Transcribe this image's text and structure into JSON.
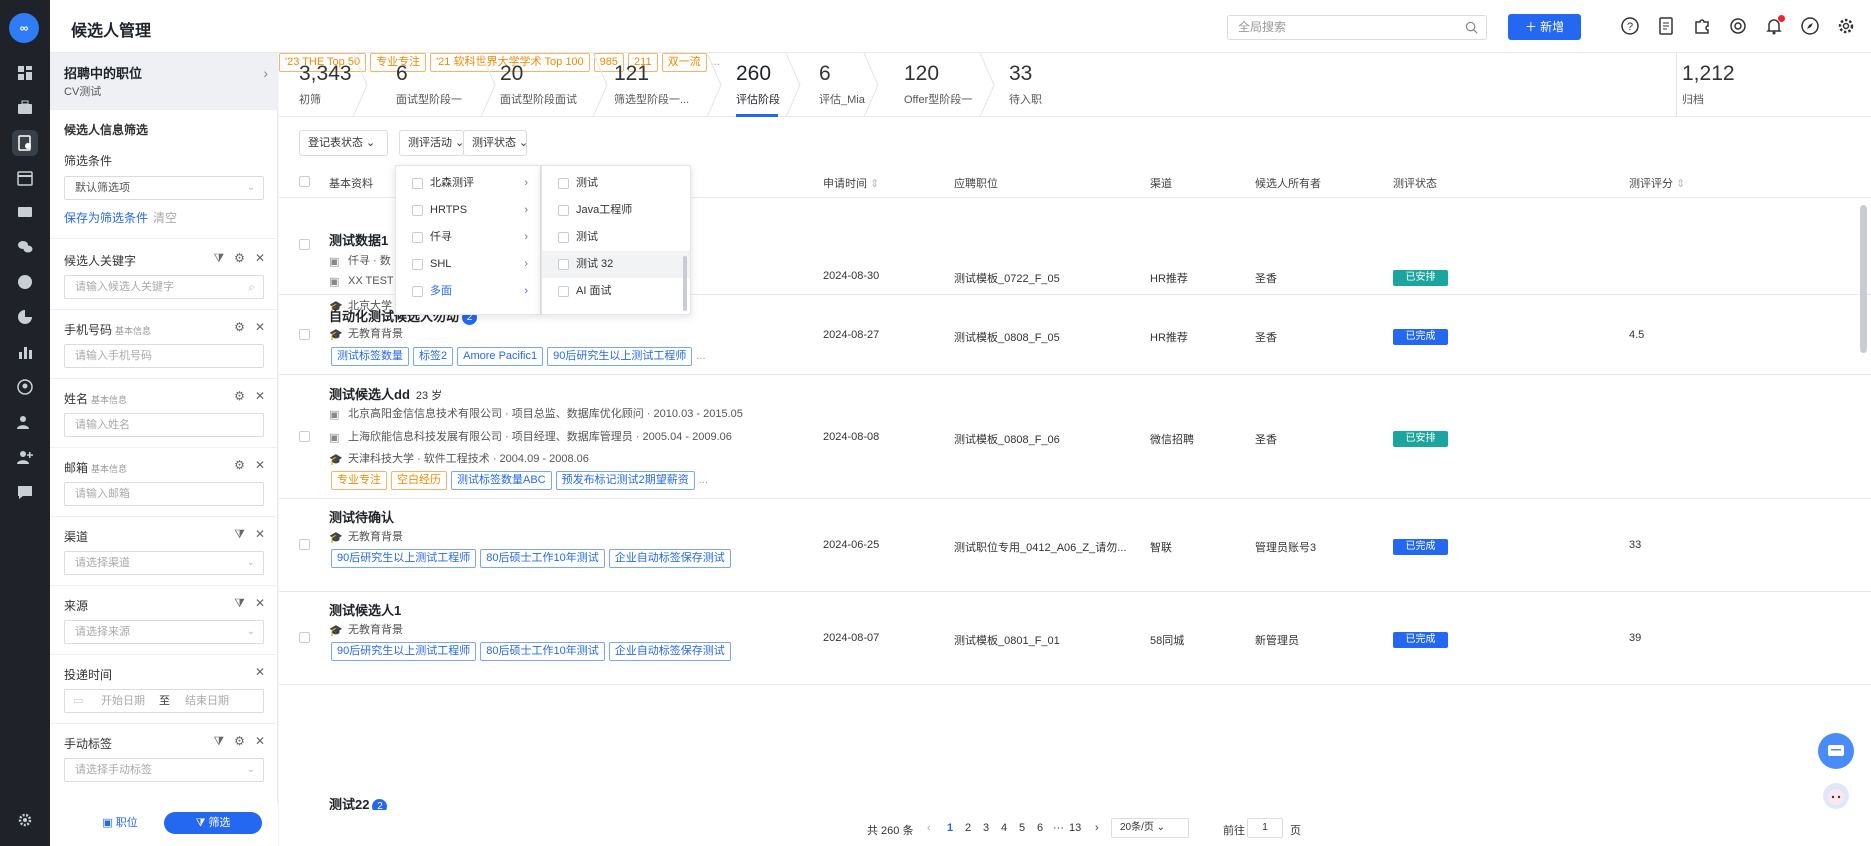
{
  "app": {
    "title": "候选人管理",
    "logo_text": "∞"
  },
  "topbar": {
    "search_placeholder": "全局搜索",
    "new_button": "＋ 新增",
    "tools": [
      "help-icon",
      "document-icon",
      "puzzle-icon",
      "support-icon",
      "bell-icon",
      "compass-icon",
      "gear-icon"
    ]
  },
  "filter_panel": {
    "header_title": "招聘中的职位",
    "header_sub": "CV测试",
    "section_title": "候选人信息筛选",
    "conditions_label": "筛选条件",
    "conditions_value": "默认筛选项",
    "save_link": "保存为筛选条件",
    "clear_link": "清空",
    "fields": [
      {
        "label": "候选人关键字",
        "tag": "",
        "placeholder": "请输入候选人关键字"
      },
      {
        "label": "手机号码",
        "tag": "基本信息",
        "placeholder": "请输入手机号码"
      },
      {
        "label": "姓名",
        "tag": "基本信息",
        "placeholder": "请输入姓名"
      },
      {
        "label": "邮箱",
        "tag": "基本信息",
        "placeholder": "请输入邮箱"
      },
      {
        "label": "渠道",
        "tag": "",
        "placeholder": "请选择渠道"
      },
      {
        "label": "来源",
        "tag": "",
        "placeholder": "请选择来源"
      },
      {
        "label": "投递时间",
        "tag": "",
        "start": "开始日期",
        "to": "至",
        "end": "结束日期"
      },
      {
        "label": "手动标签",
        "tag": "",
        "placeholder": "请选择手动标签"
      }
    ],
    "bottom_tabs": [
      "职位",
      "筛选"
    ]
  },
  "stages": [
    {
      "count": "3,343",
      "label": "初筛"
    },
    {
      "count": "6",
      "label": "面试型阶段一"
    },
    {
      "count": "20",
      "label": "面试型阶段面试"
    },
    {
      "count": "121",
      "label": "筛选型阶段一..."
    },
    {
      "count": "260",
      "label": "评估阶段",
      "active": true
    },
    {
      "count": "6",
      "label": "评估_Mia"
    },
    {
      "count": "120",
      "label": "Offer型阶段一"
    },
    {
      "count": "33",
      "label": "待入职"
    },
    {
      "count": "1,212",
      "label": "归档"
    }
  ],
  "filter_buttons": [
    "登记表状态",
    "测评活动",
    "测评状态"
  ],
  "table": {
    "headers": [
      "基本资料",
      "申请时间",
      "应聘职位",
      "渠道",
      "候选人所有者",
      "测评状态",
      "测评评分"
    ],
    "rows": [
      {
        "name": "测试数据1",
        "badge": "",
        "lines": [
          "仟寻 · 数",
          "XX TEST",
          "北京大学"
        ],
        "tags": [
          {
            "t": "'23 THE Top 50",
            "c": "o"
          },
          {
            "t": "专业专注",
            "c": "o"
          },
          {
            "t": "'21 软科世界大学学术 Top 100",
            "c": "o"
          },
          {
            "t": "985",
            "c": "o"
          },
          {
            "t": "211",
            "c": "o"
          },
          {
            "t": "双一流",
            "c": "o"
          }
        ],
        "date": "2024-08-30",
        "position": "测试模板_0722_F_05",
        "channel": "HR推荐",
        "owner": "圣香",
        "status": "已安排",
        "status_color": "teal",
        "score": ""
      },
      {
        "name": "自动化测试候选人勿动",
        "badge": "2",
        "lines": [
          "无教育背景"
        ],
        "tags": [
          {
            "t": "测试标签数量",
            "c": "b"
          },
          {
            "t": "标签2",
            "c": "b"
          },
          {
            "t": "Amore Pacific1",
            "c": "b"
          },
          {
            "t": "90后研究生以上测试工程师",
            "c": "b"
          }
        ],
        "date": "2024-08-27",
        "position": "测试模板_0808_F_05",
        "channel": "HR推荐",
        "owner": "圣香",
        "status": "已完成",
        "status_color": "blue",
        "score": "4.5"
      },
      {
        "name": "测试候选人dd",
        "badge": "",
        "age": "23 岁",
        "lines": [
          "北京高阳金信信息技术有限公司 · 项目总监、数据库优化顾问 · 2010.03 - 2015.05",
          "上海欣能信息科技发展有限公司 · 项目经理、数据库管理员 · 2005.04 - 2009.06",
          "天津科技大学 · 软件工程技术 · 2004.09 - 2008.06"
        ],
        "tags": [
          {
            "t": "专业专注",
            "c": "o"
          },
          {
            "t": "空白经历",
            "c": "o"
          },
          {
            "t": "测试标签数量ABC",
            "c": "b"
          },
          {
            "t": "预发布标记测试2期望薪资",
            "c": "b"
          }
        ],
        "date": "2024-08-08",
        "position": "测试模板_0808_F_06",
        "channel": "微信招聘",
        "owner": "圣香",
        "status": "已安排",
        "status_color": "teal",
        "score": ""
      },
      {
        "name": "测试待确认",
        "badge": "",
        "lines": [
          "无教育背景"
        ],
        "tags": [
          {
            "t": "90后研究生以上测试工程师",
            "c": "b"
          },
          {
            "t": "80后硕士工作10年测试",
            "c": "b"
          },
          {
            "t": "企业自动标签保存测试",
            "c": "b"
          }
        ],
        "date": "2024-06-25",
        "position": "测试职位专用_0412_A06_Z_请勿...",
        "channel": "智联",
        "owner": "管理员账号3",
        "status": "已完成",
        "status_color": "blue",
        "score": "33"
      },
      {
        "name": "测试候选人1",
        "badge": "",
        "lines": [
          "无教育背景"
        ],
        "tags": [
          {
            "t": "90后研究生以上测试工程师",
            "c": "b"
          },
          {
            "t": "80后硕士工作10年测试",
            "c": "b"
          },
          {
            "t": "企业自动标签保存测试",
            "c": "b"
          }
        ],
        "date": "2024-08-07",
        "position": "测试模板_0801_F_01",
        "channel": "58同城",
        "owner": "新管理员",
        "status": "已完成",
        "status_color": "blue",
        "score": "39"
      },
      {
        "name": "测试22",
        "badge": "2",
        "lines": [],
        "tags": [],
        "date": "",
        "position": "",
        "channel": "",
        "owner": "",
        "status": "",
        "status_color": "",
        "score": ""
      }
    ]
  },
  "dropdown": {
    "col1": [
      {
        "label": "北森测评"
      },
      {
        "label": "HRTPS"
      },
      {
        "label": "仟寻"
      },
      {
        "label": "SHL"
      },
      {
        "label": "多面",
        "active": true
      }
    ],
    "col2": [
      "测试",
      "Java工程师",
      "测试",
      "测试 32",
      "AI 面试"
    ]
  },
  "pager": {
    "total": "共 260 条",
    "pages": [
      "1",
      "2",
      "3",
      "4",
      "5",
      "6",
      "···",
      "13"
    ],
    "current": "1",
    "size": "20条/页",
    "goto_label": "前往",
    "goto_value": "1",
    "goto_unit": "页"
  },
  "colors": {
    "accent": "#2468f2",
    "teal": "#1ba59e",
    "orange": "#f08a00",
    "rail": "#1f2329"
  }
}
